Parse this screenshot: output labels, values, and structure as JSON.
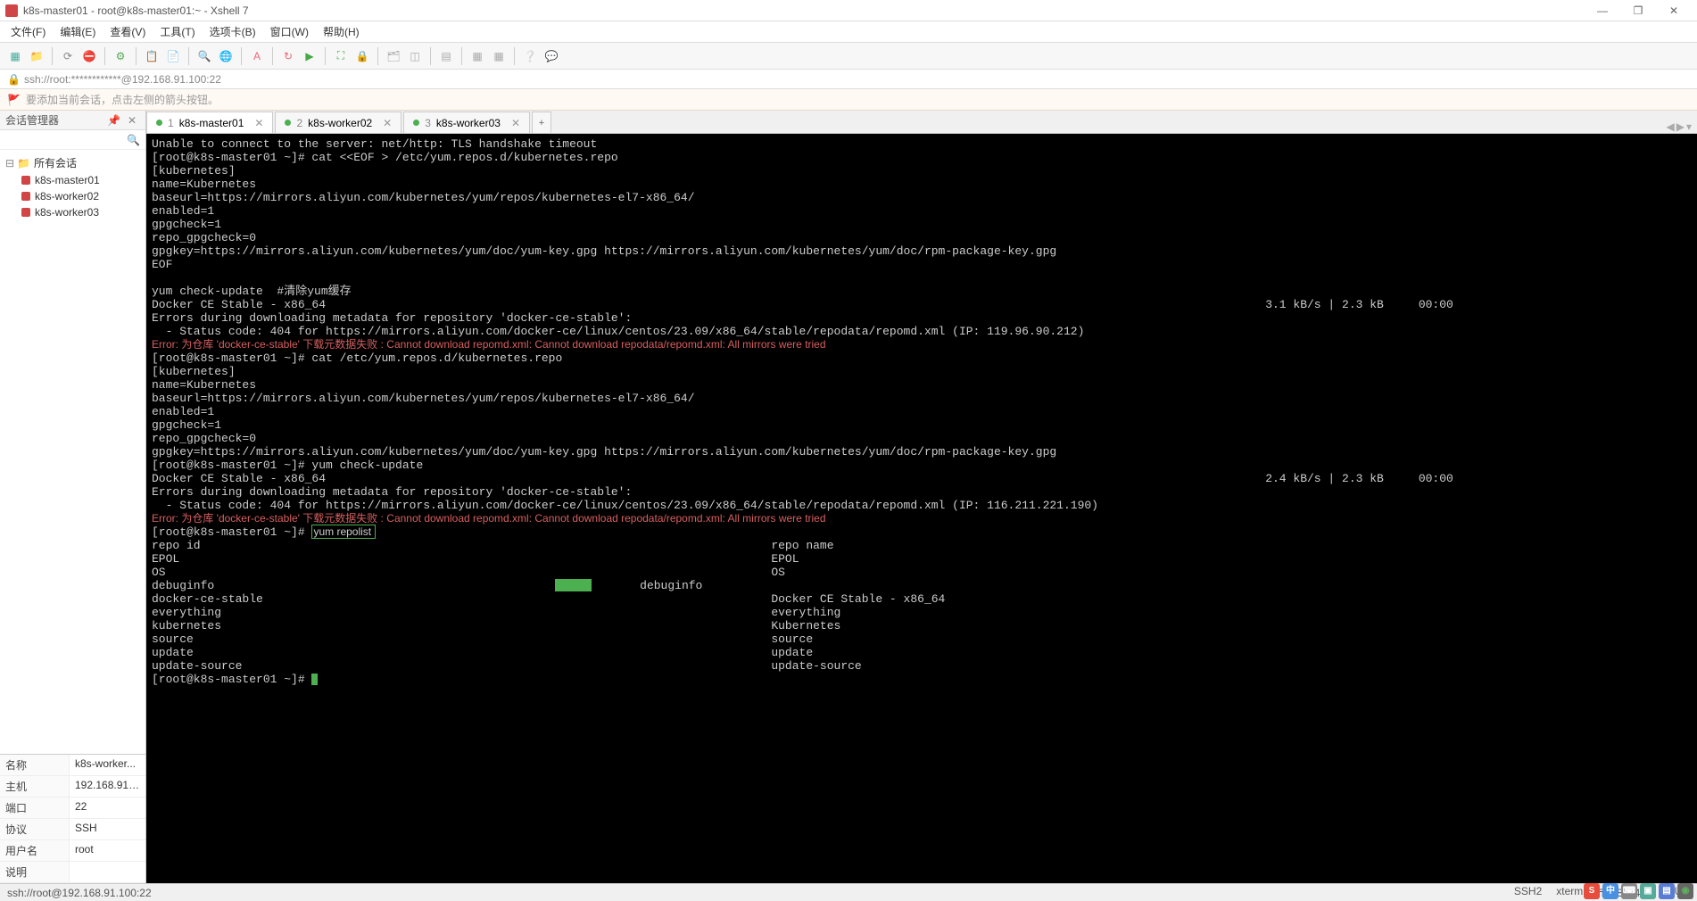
{
  "window": {
    "title": "k8s-master01 - root@k8s-master01:~ - Xshell 7",
    "min": "—",
    "max": "❐",
    "close": "✕"
  },
  "menu": {
    "file": "文件(F)",
    "edit": "编辑(E)",
    "view": "查看(V)",
    "tools": "工具(T)",
    "tabs": "选项卡(B)",
    "window": "窗口(W)",
    "help": "帮助(H)"
  },
  "address": {
    "text": "ssh://root:************@192.168.91.100:22"
  },
  "hint": {
    "text": "要添加当前会话，点击左侧的箭头按钮。"
  },
  "sidebar": {
    "title": "会话管理器",
    "root": "所有会话",
    "sessions": [
      "k8s-master01",
      "k8s-worker02",
      "k8s-worker03"
    ],
    "props": {
      "name_k": "名称",
      "name_v": "k8s-worker...",
      "host_k": "主机",
      "host_v": "192.168.91....",
      "port_k": "端口",
      "port_v": "22",
      "proto_k": "协议",
      "proto_v": "SSH",
      "user_k": "用户名",
      "user_v": "root",
      "desc_k": "说明",
      "desc_v": ""
    }
  },
  "tabs": {
    "items": [
      {
        "num": "1",
        "label": "k8s-master01",
        "active": true
      },
      {
        "num": "2",
        "label": "k8s-worker02",
        "active": false
      },
      {
        "num": "3",
        "label": "k8s-worker03",
        "active": false
      }
    ]
  },
  "terminal_lines": [
    "Unable to connect to the server: net/http: TLS handshake timeout",
    "[root@k8s-master01 ~]# cat <<EOF > /etc/yum.repos.d/kubernetes.repo",
    "[kubernetes]",
    "name=Kubernetes",
    "baseurl=https://mirrors.aliyun.com/kubernetes/yum/repos/kubernetes-el7-x86_64/",
    "enabled=1",
    "gpgcheck=1",
    "repo_gpgcheck=0",
    "gpgkey=https://mirrors.aliyun.com/kubernetes/yum/doc/yum-key.gpg https://mirrors.aliyun.com/kubernetes/yum/doc/rpm-package-key.gpg",
    "EOF",
    "",
    "yum check-update  #清除yum缓存",
    "Docker CE Stable - x86_64                                                                                                                                       3.1 kB/s | 2.3 kB     00:00",
    "Errors during downloading metadata for repository 'docker-ce-stable':",
    "  - Status code: 404 for https://mirrors.aliyun.com/docker-ce/linux/centos/23.09/x86_64/stable/repodata/repomd.xml (IP: 119.96.90.212)",
    "||RED||Error: 为仓库 'docker-ce-stable' 下载元数据失败 : Cannot download repomd.xml: Cannot download repodata/repomd.xml: All mirrors were tried",
    "[root@k8s-master01 ~]# cat /etc/yum.repos.d/kubernetes.repo",
    "[kubernetes]",
    "name=Kubernetes",
    "baseurl=https://mirrors.aliyun.com/kubernetes/yum/repos/kubernetes-el7-x86_64/",
    "enabled=1",
    "gpgcheck=1",
    "repo_gpgcheck=0",
    "gpgkey=https://mirrors.aliyun.com/kubernetes/yum/doc/yum-key.gpg https://mirrors.aliyun.com/kubernetes/yum/doc/rpm-package-key.gpg",
    "[root@k8s-master01 ~]# yum check-update",
    "Docker CE Stable - x86_64                                                                                                                                       2.4 kB/s | 2.3 kB     00:00",
    "Errors during downloading metadata for repository 'docker-ce-stable':",
    "  - Status code: 404 for https://mirrors.aliyun.com/docker-ce/linux/centos/23.09/x86_64/stable/repodata/repomd.xml (IP: 116.211.221.190)",
    "||RED||Error: 为仓库 'docker-ce-stable' 下载元数据失败 : Cannot download repomd.xml: Cannot download repodata/repomd.xml: All mirrors were tried",
    "||CMDHL||[root@k8s-master01 ~]# ||yum repolist ",
    "repo id                                                                                  repo name",
    "EPOL                                                                                     EPOL",
    "OS                                                                                       OS",
    "debuginfo                                                 ||GREENBAR||       debuginfo",
    "docker-ce-stable                                                                         Docker CE Stable - x86_64",
    "everything                                                                               everything",
    "kubernetes                                                                               Kubernetes",
    "source                                                                                   source",
    "update                                                                                   update",
    "update-source                                                                            update-source",
    "||CMDCUR||[root@k8s-master01 ~]# "
  ],
  "status": {
    "left": "ssh://root@192.168.91.100:22",
    "ssh": "SSH2",
    "term": "xterm",
    "size": "186x41",
    "other": "IUN"
  }
}
